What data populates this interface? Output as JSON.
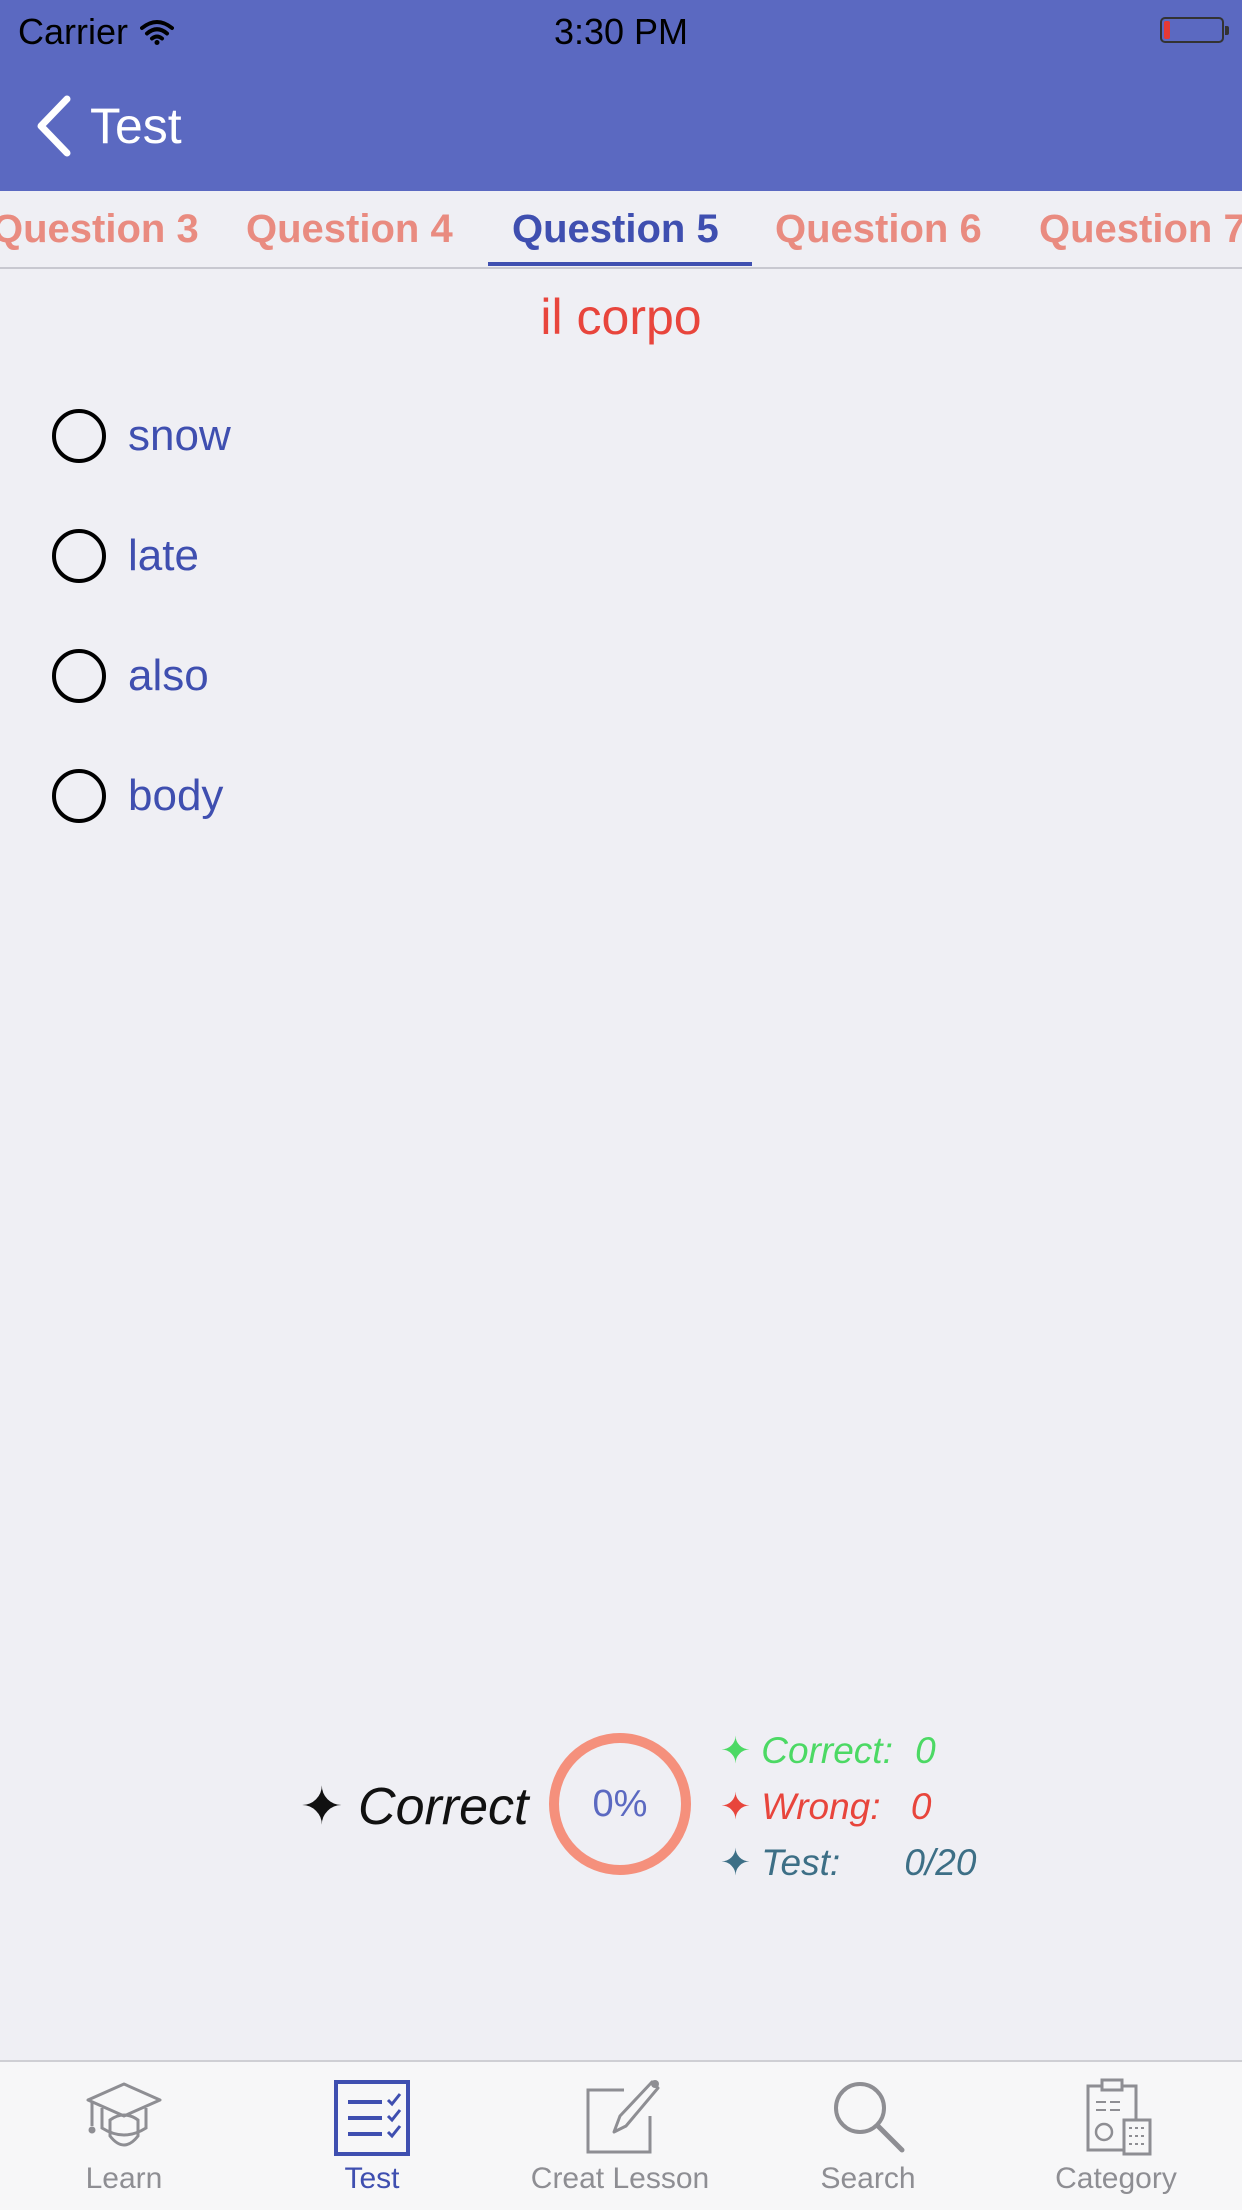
{
  "status_bar": {
    "carrier": "Carrier",
    "time": "3:30 PM"
  },
  "nav": {
    "back_title": "Test"
  },
  "tabs": [
    {
      "label": "Question 3",
      "active": false
    },
    {
      "label": "Question 4",
      "active": false
    },
    {
      "label": "Question 5",
      "active": true
    },
    {
      "label": "Question 6",
      "active": false
    },
    {
      "label": "Question 7",
      "active": false
    }
  ],
  "question": {
    "word": "il corpo",
    "options": [
      "snow",
      "late",
      "also",
      "body"
    ]
  },
  "score": {
    "result_label": "✦ Correct",
    "progress_text": "0%",
    "progress_fraction": 0,
    "correct": {
      "label": "✦ Correct:",
      "value": "0",
      "color": "#4cd964"
    },
    "wrong": {
      "label": "✦ Wrong:",
      "value": "0",
      "color": "#e8453c"
    },
    "test": {
      "label": "✦ Test:",
      "value": "0/20",
      "color": "#3d6f86"
    }
  },
  "tabbar": [
    {
      "label": "Learn",
      "icon": "graduation-cap-icon",
      "active": false
    },
    {
      "label": "Test",
      "icon": "checklist-icon",
      "active": true
    },
    {
      "label": "Creat Lesson",
      "icon": "pencil-edit-icon",
      "active": false
    },
    {
      "label": "Search",
      "icon": "search-icon",
      "active": false
    },
    {
      "label": "Category",
      "icon": "category-icon",
      "active": false
    }
  ],
  "colors": {
    "nav_background": "#5b69c1",
    "accent": "#3f4fb0",
    "inactive_tab": "#e98b80",
    "ring": "#f5907c"
  }
}
